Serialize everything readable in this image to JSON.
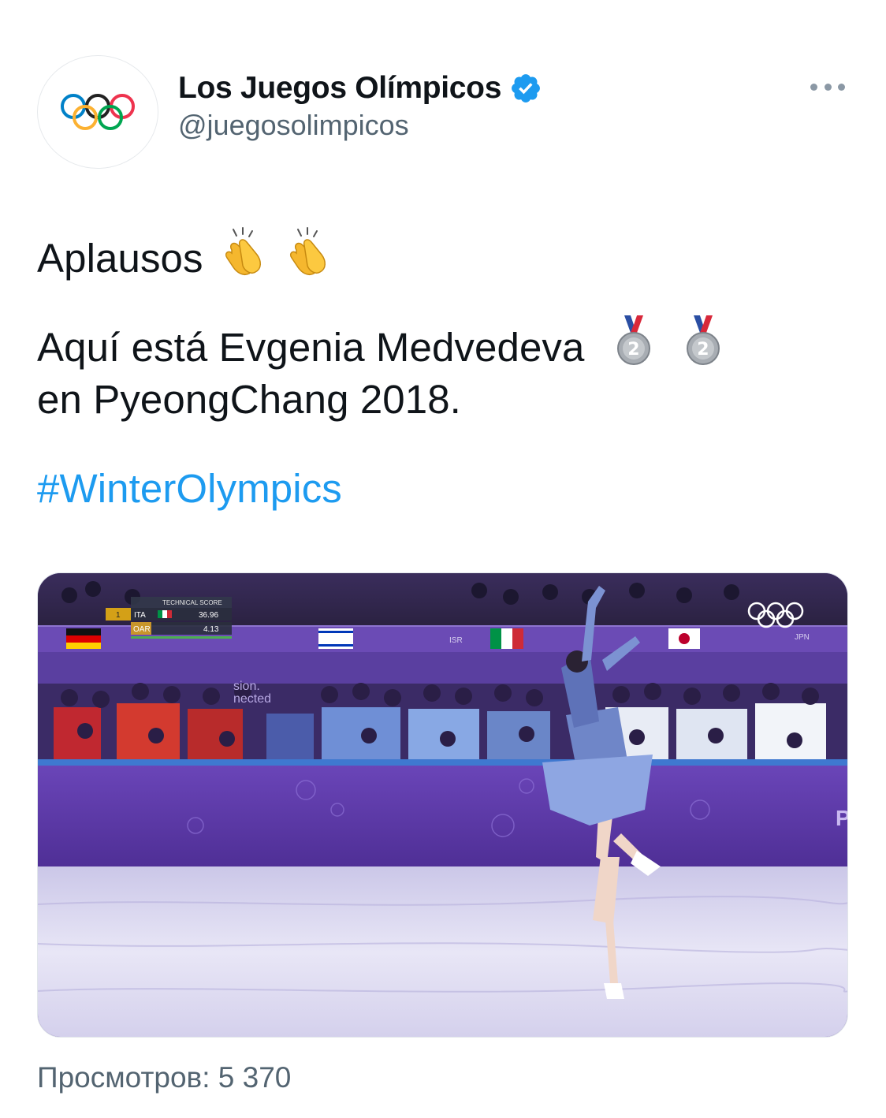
{
  "tweet": {
    "author": {
      "name": "Los Juegos Olímpicos",
      "handle": "@juegosolimpicos",
      "verified": true,
      "avatar_icon": "olympic-rings-icon"
    },
    "text": {
      "line1": "Aplausos",
      "line2": "Aquí está Evgenia Medvedeva",
      "line3": "en PyeongChang 2018.",
      "hashtag": "#WinterOlympics"
    },
    "emojis": {
      "clap": "clapping-hands-emoji",
      "medal": "silver-medal-emoji"
    },
    "media": {
      "type": "video",
      "scoreboard": {
        "title": "TECHNICAL SCORE",
        "rows": [
          {
            "rank": "1",
            "country": "ITA",
            "score": "36.96"
          },
          {
            "rank": "",
            "country": "OAR",
            "score": "4.13"
          }
        ]
      },
      "board_text": [
        "ISR",
        "JPN",
        "sion.",
        "nected"
      ]
    },
    "views_label": "Просмотров: 5 370",
    "colors": {
      "text": "#0f1419",
      "secondary": "#536471",
      "link": "#1d9bf0",
      "verified": "#1d9bf0"
    }
  }
}
